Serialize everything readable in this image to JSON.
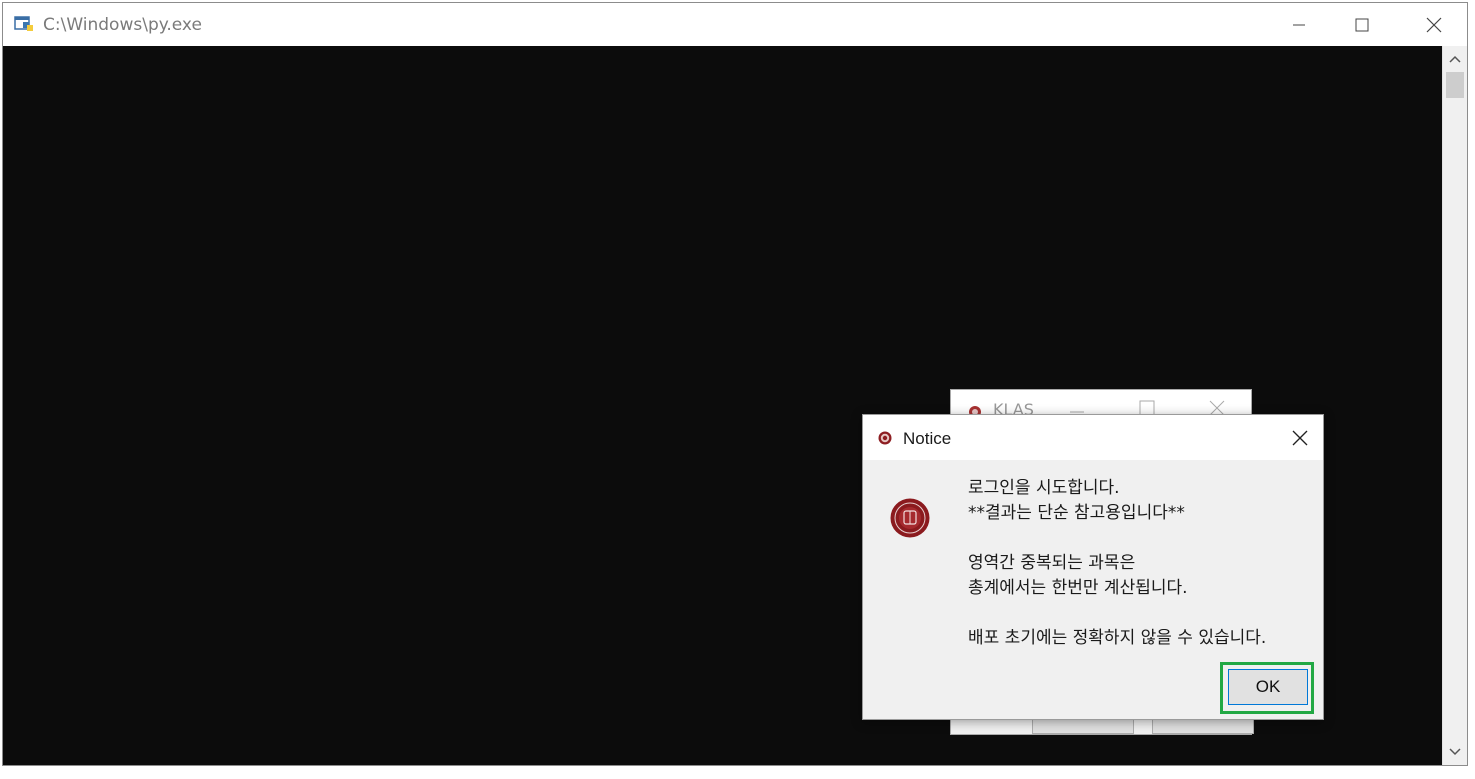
{
  "console": {
    "title": "C:\\Windows\\py.exe"
  },
  "klas": {
    "title": "KLAS"
  },
  "notice": {
    "title": "Notice",
    "lines": [
      "로그인을 시도합니다.",
      "**결과는 단순 참고용입니다**",
      "",
      "영역간 중복되는 과목은",
      "총계에서는 한번만 계산됩니다.",
      "",
      "배포 초기에는 정확하지 않을 수 있습니다."
    ],
    "ok_label": "OK",
    "highlight_color": "#22a844"
  },
  "icons": [
    "python-icon",
    "minimize-icon",
    "maximize-icon",
    "close-icon",
    "scroll-up-icon",
    "scroll-down-icon",
    "klas-seal-icon"
  ]
}
